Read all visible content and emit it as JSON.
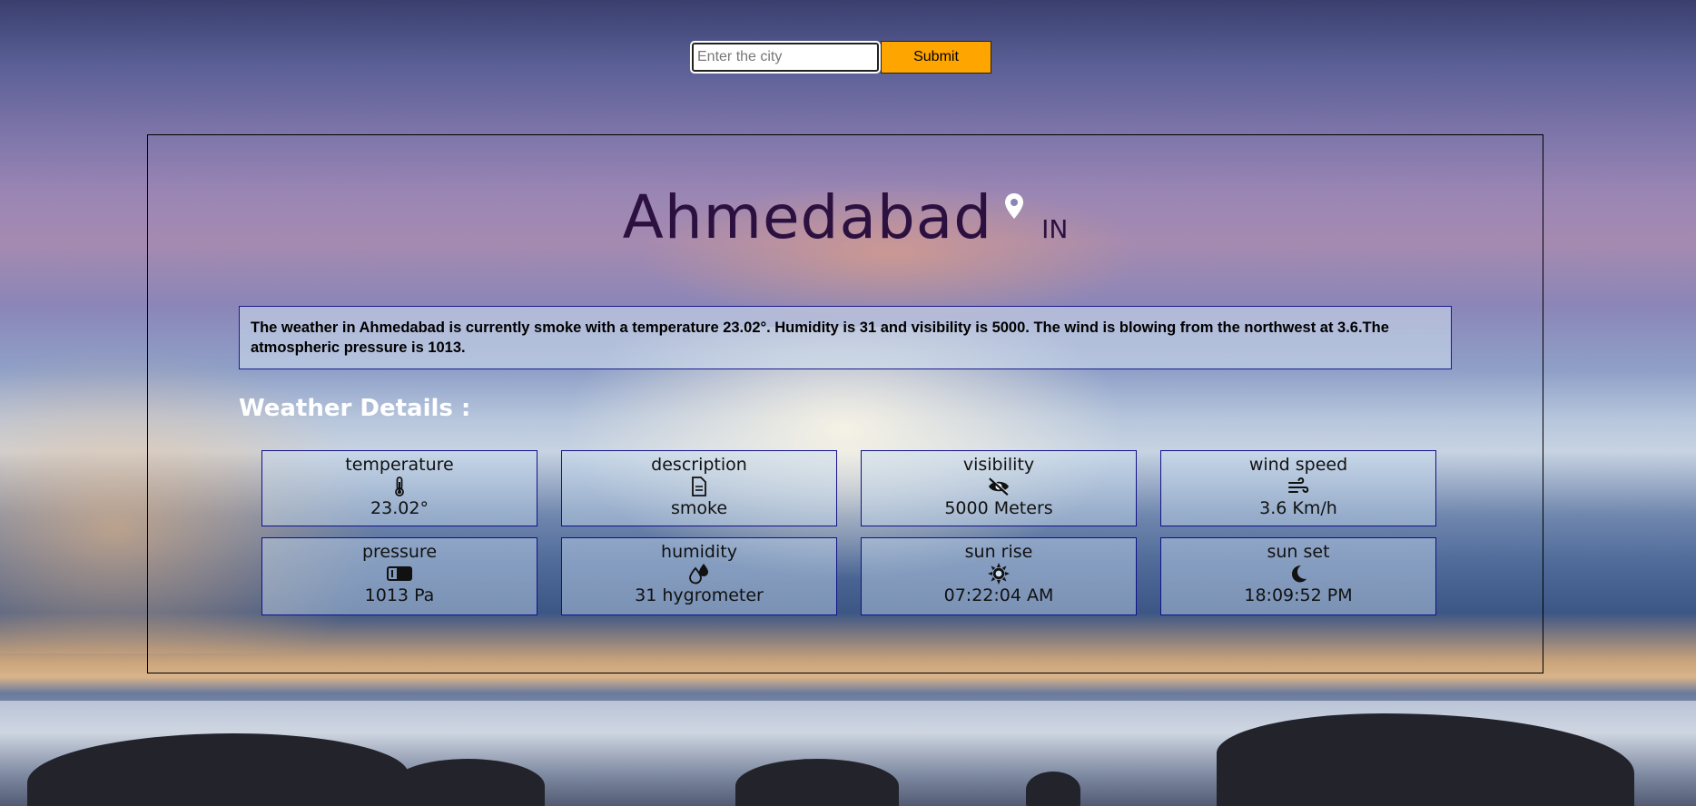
{
  "search": {
    "placeholder": "Enter the city",
    "value": "",
    "submit_label": "Submit"
  },
  "location": {
    "city": "Ahmedabad",
    "country": "IN"
  },
  "summary": "The weather in Ahmedabad is currently smoke with a temperature 23.02°. Humidity is 31 and visibility is 5000. The wind is blowing from the northwest at 3.6.The atmospheric pressure is 1013.",
  "details_heading": "Weather Details :",
  "cards": [
    {
      "label": "temperature",
      "icon": "thermometer-icon",
      "value": "23.02°"
    },
    {
      "label": "description",
      "icon": "document-icon",
      "value": "smoke"
    },
    {
      "label": "visibility",
      "icon": "eye-slash-icon",
      "value": "5000 Meters"
    },
    {
      "label": "wind speed",
      "icon": "wind-icon",
      "value": "3.6 Km/h"
    },
    {
      "label": "pressure",
      "icon": "pressure-icon",
      "value": "1013 Pa"
    },
    {
      "label": "humidity",
      "icon": "droplets-icon",
      "value": "31 hygrometer"
    },
    {
      "label": "sun rise",
      "icon": "sun-icon",
      "value": "07:22:04 AM"
    },
    {
      "label": "sun set",
      "icon": "moon-icon",
      "value": "18:09:52 PM"
    }
  ],
  "colors": {
    "submit_button": "#ffa500",
    "city_text": "#2c1040",
    "card_border": "#12128a"
  }
}
